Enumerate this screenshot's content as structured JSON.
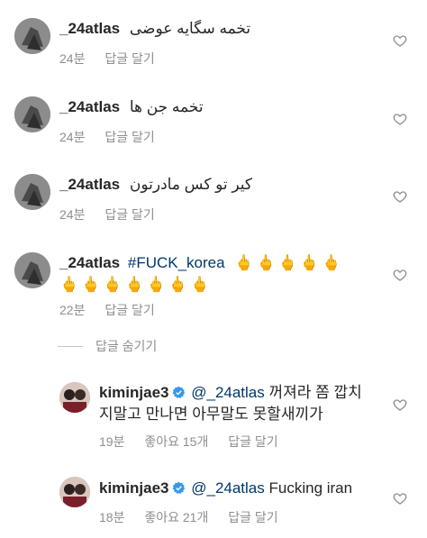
{
  "comments": [
    {
      "username": "_24atlas",
      "text": "تخمه سگایه عوضی",
      "time": "24분",
      "reply_label": "답글 달기"
    },
    {
      "username": "_24atlas",
      "text": "تخمه جن ها",
      "time": "24분",
      "reply_label": "답글 달기"
    },
    {
      "username": "_24atlas",
      "text": "کیر تو کس مادرتون",
      "time": "24분",
      "reply_label": "답글 달기"
    },
    {
      "username": "_24atlas",
      "hashtag": "#FUCK_korea",
      "emoji_line1": "🖕🖕🖕🖕🖕",
      "emoji_line2": "🖕🖕🖕🖕🖕🖕🖕",
      "time": "22분",
      "reply_label": "답글 달기"
    }
  ],
  "hide_replies_label": "답글 숨기기",
  "replies": [
    {
      "username": "kiminjae3",
      "mention": "@_24atlas",
      "text_line1": "꺼져라 쫌 깝치",
      "text_line2": "지말고 만나면 아무말도 못할새끼가",
      "time": "19분",
      "likes": "좋아요 15개",
      "reply_label": "답글 달기"
    },
    {
      "username": "kiminjae3",
      "mention": "@_24atlas",
      "text_line1": "Fucking iran",
      "time": "18분",
      "likes": "좋아요 21개",
      "reply_label": "답글 달기"
    }
  ],
  "icons": {
    "heart": "heart-outline-icon",
    "verified": "verified-badge-icon"
  },
  "colors": {
    "text": "#262626",
    "secondary": "#8e8e8e",
    "link": "#00376b",
    "verified": "#3897f0"
  }
}
